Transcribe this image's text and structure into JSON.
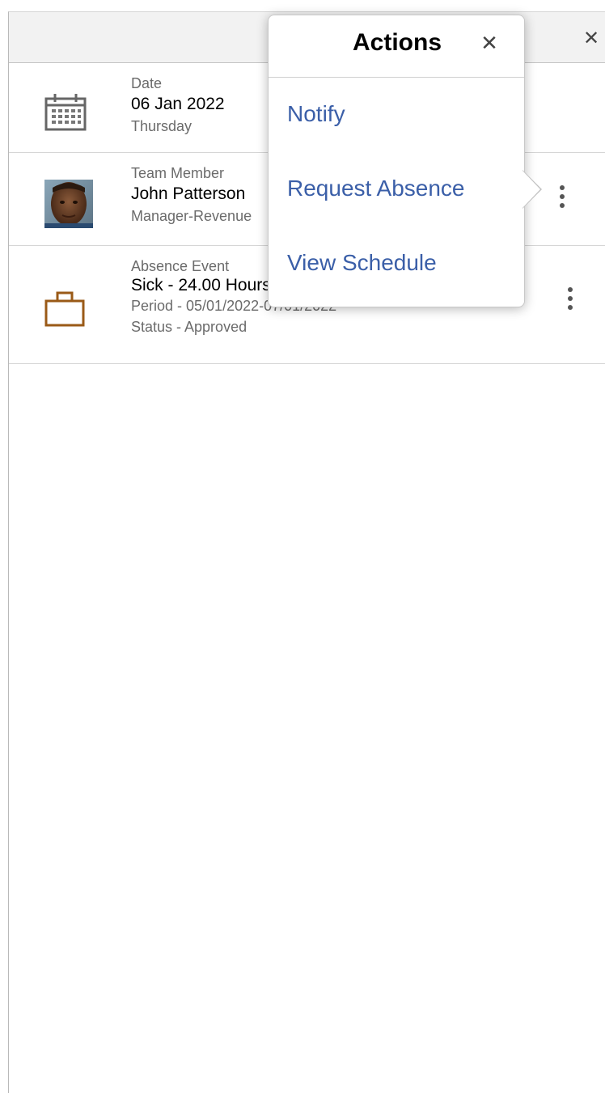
{
  "panel": {
    "close_glyph": "✕"
  },
  "rows": [
    {
      "icon": "calendar-icon",
      "label": "Date",
      "value": "06 Jan 2022",
      "sub": [
        "Thursday"
      ]
    },
    {
      "icon": "team-member-photo",
      "label": "Team Member",
      "value": "John Patterson",
      "sub": [
        "Manager-Revenue"
      ]
    },
    {
      "icon": "briefcase-icon",
      "label": "Absence Event",
      "value": "Sick - 24.00 Hours",
      "sub": [
        "Period - 05/01/2022-07/01/2022",
        "Status - Approved"
      ]
    }
  ],
  "actions_popover": {
    "title": "Actions",
    "close_glyph": "✕",
    "items": [
      "Notify",
      "Request Absence",
      "View Schedule"
    ]
  },
  "colors": {
    "link": "#3b5fa8",
    "briefcase": "#9a5a17",
    "header_bg": "#f2f2f2"
  }
}
